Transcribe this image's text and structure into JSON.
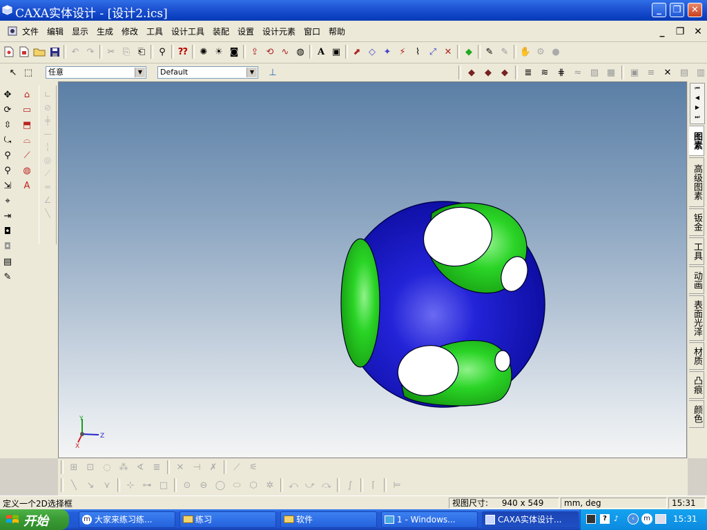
{
  "window": {
    "title": "CAXA实体设计 - [设计2.ics]"
  },
  "menu": [
    "文件",
    "编辑",
    "显示",
    "生成",
    "修改",
    "工具",
    "设计工具",
    "装配",
    "设置",
    "设计元素",
    "窗口",
    "帮助"
  ],
  "toolbar": {
    "select_mode": "任意",
    "style": "Default"
  },
  "right_tabs": [
    "图素",
    "高级图素",
    "钣金",
    "工具",
    "动画",
    "表面光泽",
    "材质",
    "凸痕",
    "颜色"
  ],
  "axis": {
    "x": "X",
    "y": "Y",
    "z": "Z"
  },
  "status": {
    "message": "定义一个2D选择框",
    "view_label": "视图尺寸:",
    "view_size": "940 x 549",
    "units": "mm, deg",
    "time": "15:31"
  },
  "taskbar": {
    "start": "开始",
    "tasks": [
      "大家来练习练...",
      "练习",
      "软件",
      "1 - Windows...",
      "CAXA实体设计..."
    ],
    "clock": "15:31"
  },
  "colors": {
    "sphere_outer": "#1414c8",
    "sphere_inner": "#22c41e",
    "title_bar": "#0a3fc0"
  }
}
